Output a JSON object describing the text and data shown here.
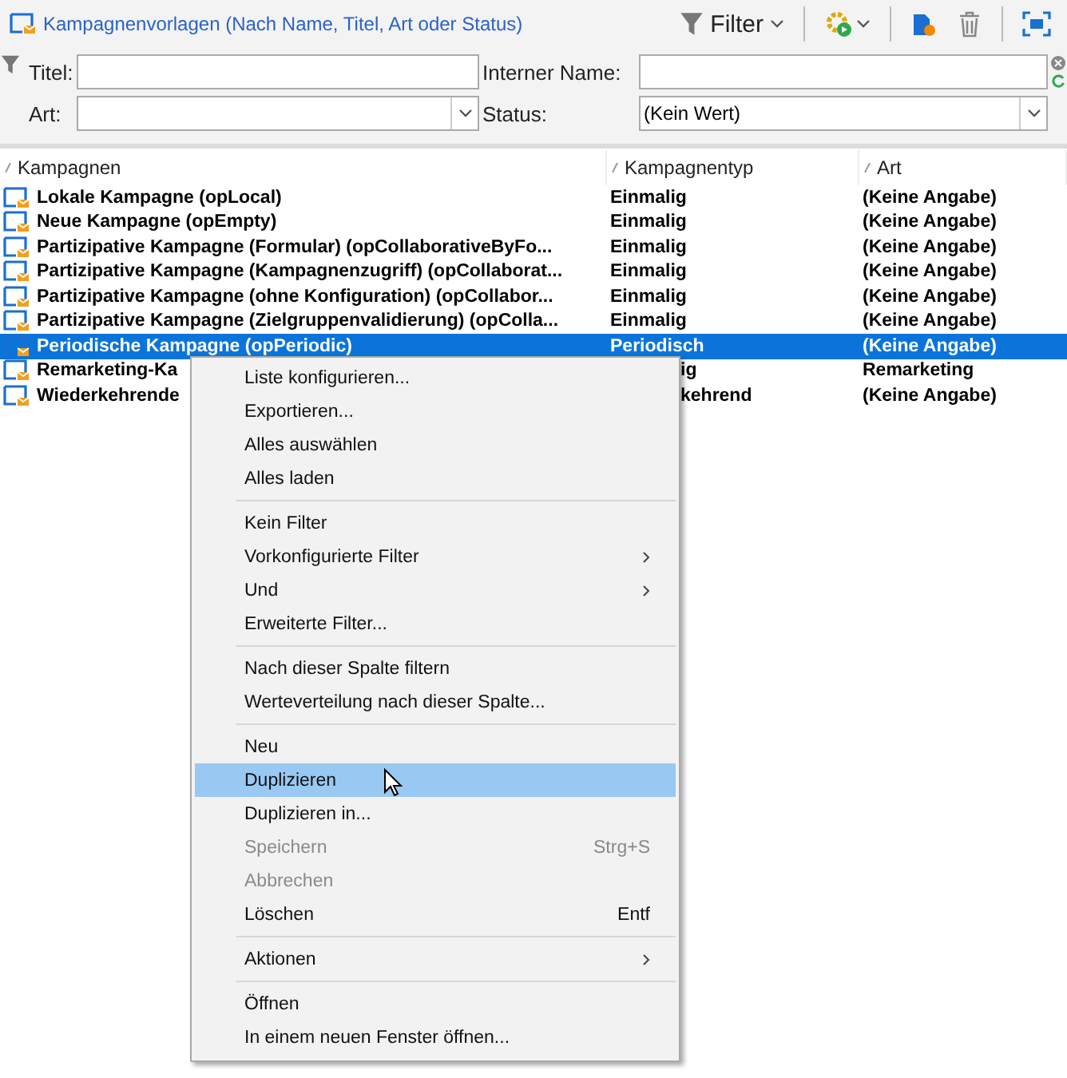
{
  "header": {
    "title": "Kampagnenvorlagen (Nach Name, Titel, Art oder Status)",
    "filter_button": "Filter"
  },
  "filters": [
    {
      "label": "Titel:",
      "kind": "text"
    },
    {
      "label": "Interner Name:",
      "kind": "text"
    },
    {
      "label": "Art:",
      "kind": "select"
    },
    {
      "label": "Status:",
      "kind": "select",
      "value": "(Kein Wert)"
    }
  ],
  "table": {
    "columns": [
      "Kampagnen",
      "Kampagnentyp",
      "Art"
    ],
    "rows": [
      {
        "cells": [
          "Lokale Kampagne (opLocal)",
          "Einmalig",
          "(Keine Angabe)"
        ],
        "selected": false,
        "covered": false
      },
      {
        "cells": [
          "Neue Kampagne (opEmpty)",
          "Einmalig",
          "(Keine Angabe)"
        ],
        "selected": false,
        "covered": false
      },
      {
        "cells": [
          "Partizipative Kampagne (Formular) (opCollaborativeByFo...",
          "Einmalig",
          "(Keine Angabe)"
        ],
        "selected": false,
        "covered": false
      },
      {
        "cells": [
          "Partizipative Kampagne (Kampagnenzugriff) (opCollaborat...",
          "Einmalig",
          "(Keine Angabe)"
        ],
        "selected": false,
        "covered": false
      },
      {
        "cells": [
          "Partizipative Kampagne (ohne Konfiguration) (opCollabor...",
          "Einmalig",
          "(Keine Angabe)"
        ],
        "selected": false,
        "covered": false
      },
      {
        "cells": [
          "Partizipative Kampagne (Zielgruppenvalidierung) (opColla...",
          "Einmalig",
          "(Keine Angabe)"
        ],
        "selected": false,
        "covered": false
      },
      {
        "cells": [
          "Periodische Kampagne (opPeriodic)",
          "Periodisch",
          "(Keine Angabe)"
        ],
        "selected": true,
        "covered": false
      },
      {
        "cells": [
          "Remarketing-Ka",
          "ig",
          "Remarketing"
        ],
        "selected": false,
        "covered": true
      },
      {
        "cells": [
          "Wiederkehrende",
          "kehrend",
          "(Keine Angabe)"
        ],
        "selected": false,
        "covered": true
      }
    ]
  },
  "context_menu": [
    {
      "kind": "item",
      "label": "Liste konfigurieren...",
      "disabled": false,
      "selected": false,
      "submenu": false
    },
    {
      "kind": "item",
      "label": "Exportieren...",
      "disabled": false,
      "selected": false,
      "submenu": false
    },
    {
      "kind": "item",
      "label": "Alles auswählen",
      "disabled": false,
      "selected": false,
      "submenu": false
    },
    {
      "kind": "item",
      "label": "Alles laden",
      "disabled": false,
      "selected": false,
      "submenu": false
    },
    {
      "kind": "separator"
    },
    {
      "kind": "item",
      "label": "Kein Filter",
      "disabled": false,
      "selected": false,
      "submenu": false
    },
    {
      "kind": "item",
      "label": "Vorkonfigurierte Filter",
      "disabled": false,
      "selected": false,
      "submenu": true
    },
    {
      "kind": "item",
      "label": "Und",
      "disabled": false,
      "selected": false,
      "submenu": true
    },
    {
      "kind": "item",
      "label": "Erweiterte Filter...",
      "disabled": false,
      "selected": false,
      "submenu": false
    },
    {
      "kind": "separator"
    },
    {
      "kind": "item",
      "label": "Nach dieser Spalte filtern",
      "disabled": false,
      "selected": false,
      "submenu": false
    },
    {
      "kind": "item",
      "label": "Werteverteilung nach dieser Spalte...",
      "disabled": false,
      "selected": false,
      "submenu": false
    },
    {
      "kind": "separator"
    },
    {
      "kind": "item",
      "label": "Neu",
      "disabled": false,
      "selected": false,
      "submenu": false
    },
    {
      "kind": "item",
      "label": "Duplizieren",
      "disabled": false,
      "selected": true,
      "submenu": false
    },
    {
      "kind": "item",
      "label": "Duplizieren in...",
      "disabled": false,
      "selected": false,
      "submenu": false
    },
    {
      "kind": "item",
      "label": "Speichern",
      "shortcut": "Strg+S",
      "disabled": true,
      "selected": false,
      "submenu": false
    },
    {
      "kind": "item",
      "label": "Abbrechen",
      "disabled": true,
      "selected": false,
      "submenu": false
    },
    {
      "kind": "item",
      "label": "Löschen",
      "shortcut": "Entf",
      "disabled": false,
      "selected": false,
      "submenu": false
    },
    {
      "kind": "separator"
    },
    {
      "kind": "item",
      "label": "Aktionen",
      "disabled": false,
      "selected": false,
      "submenu": true
    },
    {
      "kind": "separator"
    },
    {
      "kind": "item",
      "label": "Öffnen",
      "disabled": false,
      "selected": false,
      "submenu": false
    },
    {
      "kind": "item",
      "label": "In einem neuen Fenster öffnen...",
      "disabled": false,
      "selected": false,
      "submenu": false
    }
  ]
}
